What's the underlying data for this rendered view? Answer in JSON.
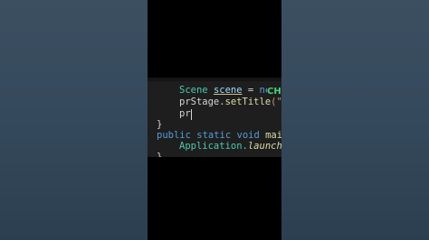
{
  "editor": {
    "lines": [
      {
        "p1": "Scene ",
        "p2": "scene",
        "p3": " = ",
        "p4": "new S"
      },
      {
        "p1": "prStage.",
        "p2": "setTitle",
        "p3": "(\"S"
      },
      {
        "p1": "pr"
      },
      {
        "p1": "}"
      },
      {
        "p1": "public static void ",
        "p2": "main"
      },
      {
        "p1": "Application.",
        "p2": "launch",
        "p3": "("
      },
      {
        "p1": "}"
      }
    ],
    "badge": "CH"
  },
  "colors": {
    "background_side": "#34495b",
    "editor_bg": "#1e1e1e",
    "keyword": "#569cd6",
    "type": "#4ec9b0",
    "method": "#dcdcaa",
    "text": "#d4d4d4",
    "string": "#ce9178",
    "badge": "#46d37a"
  }
}
